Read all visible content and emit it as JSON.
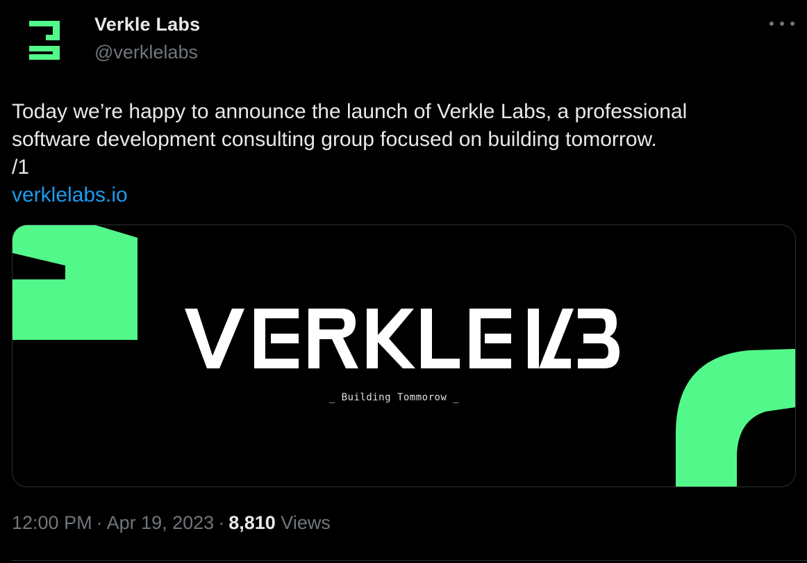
{
  "author": {
    "name": "Verkle Labs",
    "handle": "@verklelabs",
    "avatar_icon": "verkle-logo-icon"
  },
  "more_icon": "more-dots-icon",
  "tweet": {
    "lines": [
      "Today we’re happy to announce the launch of Verkle Labs, a professional",
      "software development consulting group focused on building tomorrow.",
      "/1"
    ],
    "link": "verklelabs.io"
  },
  "media": {
    "logo_text": "VERKLE LABS",
    "tagline": "_ Building Tommorow _",
    "accent_color": "#52f98a"
  },
  "meta": {
    "time": "12:00 PM",
    "date": "Apr 19, 2023",
    "views_count": "8,810",
    "views_label": "Views",
    "separator": "·"
  },
  "colors": {
    "background": "#000000",
    "text": "#e7e9ea",
    "muted": "#71767b",
    "link": "#1d9bf0",
    "accent": "#52f98a"
  }
}
